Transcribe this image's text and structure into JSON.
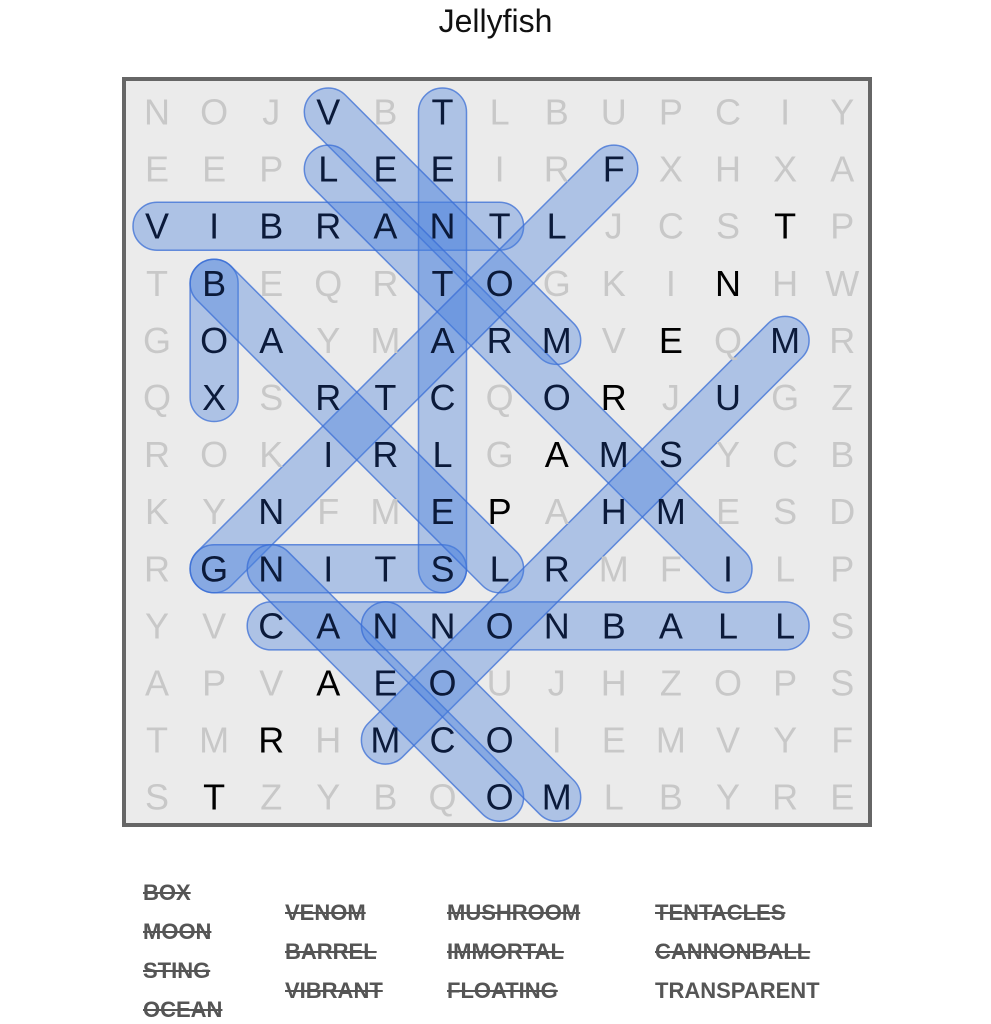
{
  "title": "Jellyfish",
  "grid": {
    "rows": [
      "NOJVBTLBUPCIY",
      "EEPLEEIRFXHXA",
      "VIBRANTLJCSTP",
      "TBEQRTOGKINHW",
      "GOAYMARMVEQMR",
      "QXSRTCQORJUGZ",
      "ROKIRLGAMSYCB",
      "KYNFMEPAHMESD",
      "RGNITSLRMFILP",
      "YVCANNONBALLS",
      "APVAEOUJHZOPS",
      "TMRHMCOIEMVYF",
      "STZYBQOMLBYRE"
    ],
    "highlight_color": "#4a80de"
  },
  "found_placements": [
    {
      "word": "VIBRANT",
      "start": [
        2,
        0
      ],
      "end": [
        2,
        6
      ]
    },
    {
      "word": "TENTACLES",
      "start": [
        0,
        5
      ],
      "end": [
        8,
        5
      ]
    },
    {
      "word": "BOX",
      "start": [
        3,
        1
      ],
      "end": [
        5,
        1
      ]
    },
    {
      "word": "VENOM",
      "start": [
        0,
        3
      ],
      "end": [
        4,
        7
      ]
    },
    {
      "word": "IMMORTAL",
      "start": [
        8,
        10
      ],
      "end": [
        1,
        3
      ]
    },
    {
      "word": "FLOATING",
      "start": [
        1,
        8
      ],
      "end": [
        8,
        1
      ]
    },
    {
      "word": "STING",
      "start": [
        8,
        5
      ],
      "end": [
        8,
        1
      ]
    },
    {
      "word": "CANNONBALL",
      "start": [
        9,
        2
      ],
      "end": [
        9,
        11
      ]
    },
    {
      "word": "BARREL",
      "start": [
        3,
        1
      ],
      "end": [
        8,
        6
      ]
    },
    {
      "word": "MUSHROOM",
      "start": [
        4,
        11
      ],
      "end": [
        11,
        4
      ]
    },
    {
      "word": "OCEAN",
      "start": [
        12,
        6
      ],
      "end": [
        8,
        2
      ]
    },
    {
      "word": "MOON",
      "start": [
        12,
        7
      ],
      "end": [
        9,
        4
      ]
    }
  ],
  "unfound_letters": [
    [
      3,
      10
    ],
    [
      2,
      11
    ],
    [
      4,
      9
    ],
    [
      5,
      8
    ],
    [
      6,
      7
    ],
    [
      7,
      6
    ],
    [
      10,
      3
    ],
    [
      11,
      2
    ],
    [
      12,
      1
    ]
  ],
  "word_list": {
    "columns": [
      [
        {
          "word": "BOX",
          "found": true
        },
        {
          "word": "MOON",
          "found": true
        },
        {
          "word": "STING",
          "found": true
        },
        {
          "word": "OCEAN",
          "found": true
        }
      ],
      [
        {
          "word": "VENOM",
          "found": true
        },
        {
          "word": "BARREL",
          "found": true
        },
        {
          "word": "VIBRANT",
          "found": true
        }
      ],
      [
        {
          "word": "MUSHROOM",
          "found": true
        },
        {
          "word": "IMMORTAL",
          "found": true
        },
        {
          "word": "FLOATING",
          "found": true
        }
      ],
      [
        {
          "word": "TENTACLES",
          "found": true
        },
        {
          "word": "CANNONBALL",
          "found": true
        },
        {
          "word": "TRANSPARENT",
          "found": false
        }
      ]
    ]
  }
}
